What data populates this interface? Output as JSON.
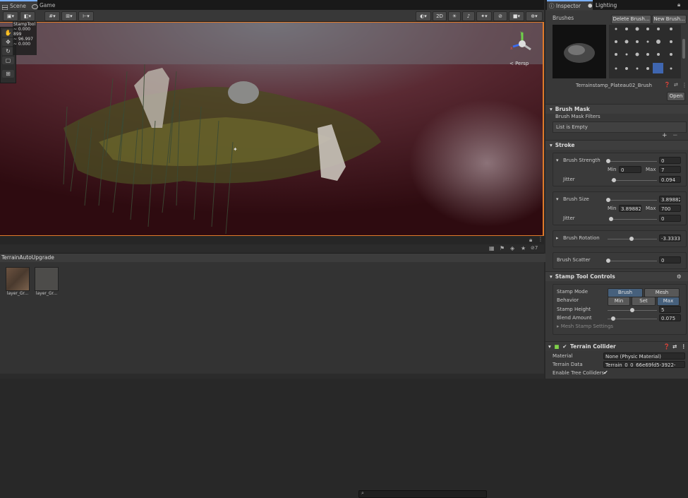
{
  "tabs": {
    "scene": "Scene",
    "game": "Game"
  },
  "scene_view": {
    "overlay_title": "StampTool",
    "overlay_values": [
      "~ 0.000",
      "899",
      "~ 96.997",
      "~ 0.000"
    ],
    "persp_label": "< Persp",
    "button_2d": "2D"
  },
  "project": {
    "breadcrumb": "TerrainAutoUpgrade",
    "assets": [
      {
        "label": "layer_Gr..."
      },
      {
        "label": "layer_Gr..."
      }
    ],
    "count_badge": "7"
  },
  "inspector": {
    "tab_inspector": "Inspector",
    "tab_lighting": "Lighting",
    "brushes_label": "Brushes",
    "delete_brush": "Delete Brush...",
    "new_brush": "New Brush...",
    "brush_name": "Terrainstamp_Plateau02_Brush",
    "open_button": "Open",
    "brush_mask": {
      "header": "Brush Mask",
      "filters_label": "Brush Mask Filters",
      "list_empty": "List is Empty"
    },
    "stroke": {
      "header": "Stroke",
      "strength_label": "Brush Strength",
      "strength_value": "0",
      "min_label": "Min",
      "max_label": "Max",
      "strength_min": "0",
      "strength_max": "7",
      "jitter_label": "Jitter",
      "strength_jitter": "0.094",
      "size_label": "Brush Size",
      "size_value": "3.89882",
      "size_min": "3.89882",
      "size_max": "700",
      "size_jitter": "0",
      "rotation_label": "Brush Rotation",
      "rotation_value": "-3.3333",
      "scatter_label": "Brush Scatter",
      "scatter_value": "0"
    },
    "stamp": {
      "header": "Stamp Tool Controls",
      "mode_label": "Stamp Mode",
      "mode_brush": "Brush",
      "mode_mesh": "Mesh",
      "behavior_label": "Behavior",
      "beh_min": "Min",
      "beh_set": "Set",
      "beh_max": "Max",
      "height_label": "Stamp Height",
      "height_value": "5",
      "blend_label": "Blend Amount",
      "blend_value": "0.075",
      "mesh_settings": "Mesh Stamp Settings"
    },
    "collider": {
      "header": "Terrain Collider",
      "material_label": "Material",
      "material_value": "None (Physic Material)",
      "data_label": "Terrain Data",
      "data_value": "Terrain_0_0_66e69fd5-3922-",
      "trees_label": "Enable Tree Colliders"
    }
  }
}
